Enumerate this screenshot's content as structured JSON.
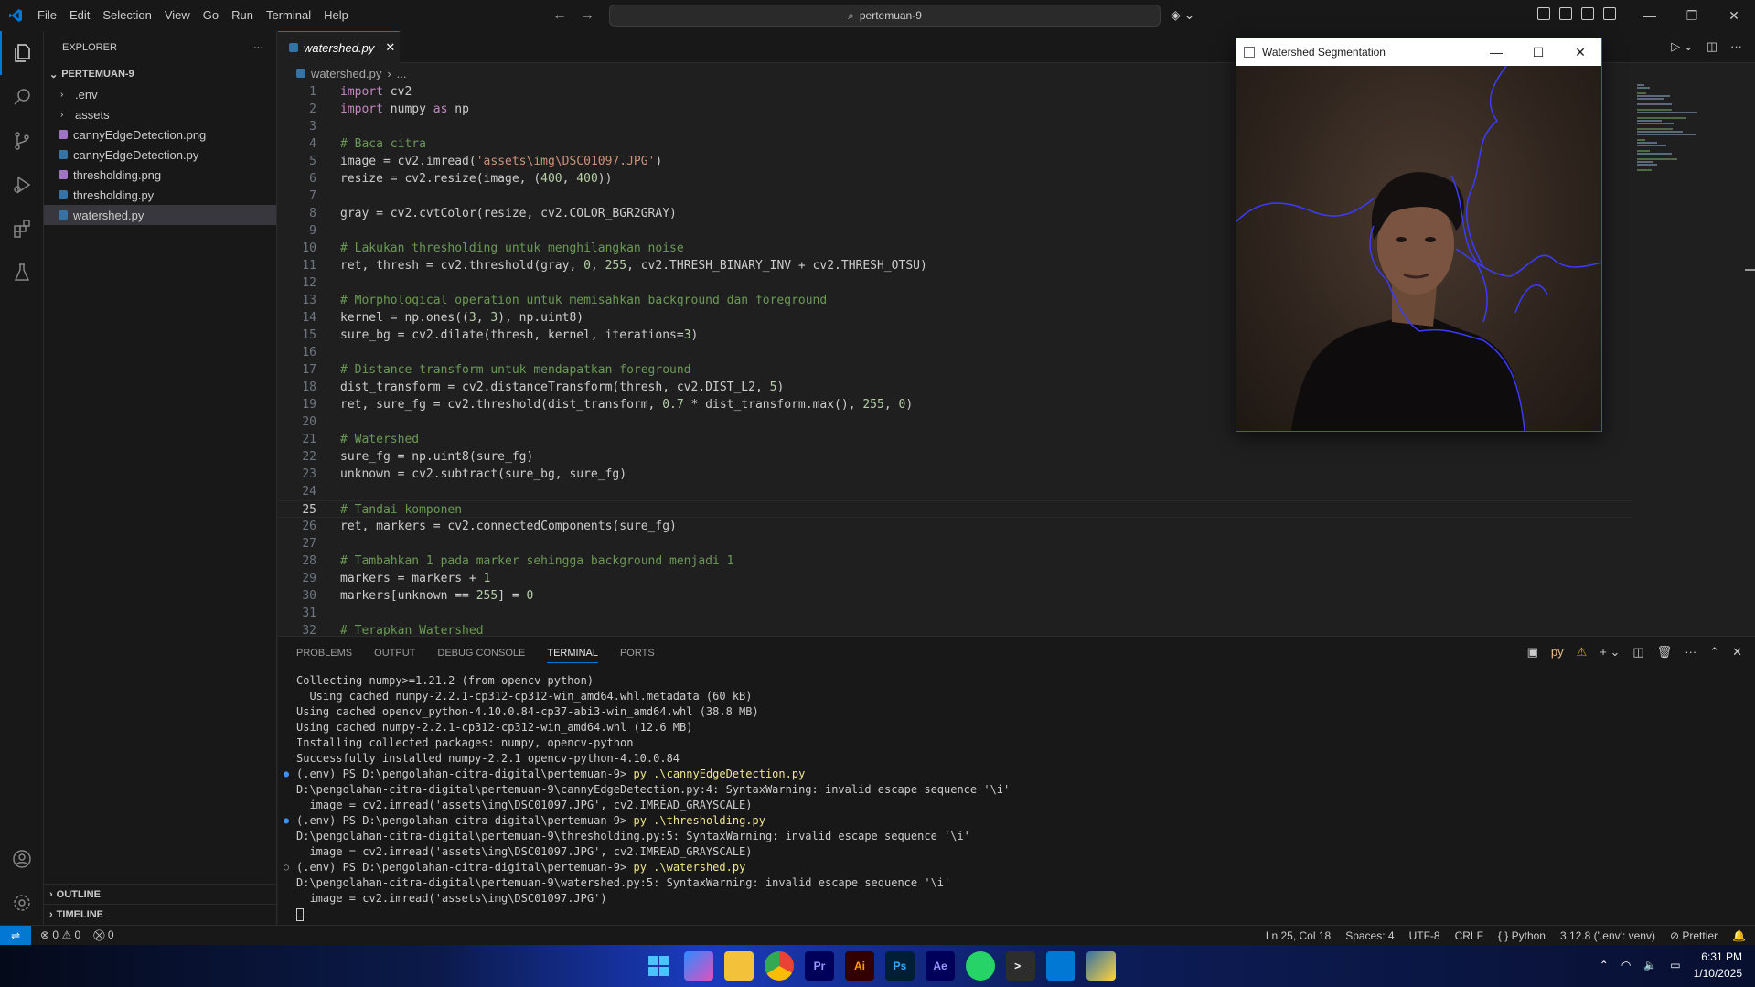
{
  "titlebar": {
    "menu": [
      "File",
      "Edit",
      "Selection",
      "View",
      "Go",
      "Run",
      "Terminal",
      "Help"
    ],
    "search_text": "pertemuan-9"
  },
  "explorer": {
    "title": "EXPLORER",
    "folder": "PERTEMUAN-9",
    "items": [
      {
        "name": ".env",
        "kind": "folder"
      },
      {
        "name": "assets",
        "kind": "folder"
      },
      {
        "name": "cannyEdgeDetection.png",
        "kind": "png"
      },
      {
        "name": "cannyEdgeDetection.py",
        "kind": "py"
      },
      {
        "name": "thresholding.png",
        "kind": "png"
      },
      {
        "name": "thresholding.py",
        "kind": "py"
      },
      {
        "name": "watershed.py",
        "kind": "py",
        "selected": true
      }
    ],
    "outline": "OUTLINE",
    "timeline": "TIMELINE"
  },
  "editor": {
    "tab_label": "watershed.py",
    "breadcrumb_file": "watershed.py",
    "breadcrumb_more": "...",
    "current_line": 25,
    "lines": [
      "import cv2",
      "import numpy as np",
      "",
      "# Baca citra",
      "image = cv2.imread('assets\\img\\DSC01097.JPG')",
      "resize = cv2.resize(image, (400, 400))",
      "",
      "gray = cv2.cvtColor(resize, cv2.COLOR_BGR2GRAY)",
      "",
      "# Lakukan thresholding untuk menghilangkan noise",
      "ret, thresh = cv2.threshold(gray, 0, 255, cv2.THRESH_BINARY_INV + cv2.THRESH_OTSU)",
      "",
      "# Morphological operation untuk memisahkan background dan foreground",
      "kernel = np.ones((3, 3), np.uint8)",
      "sure_bg = cv2.dilate(thresh, kernel, iterations=3)",
      "",
      "# Distance transform untuk mendapatkan foreground",
      "dist_transform = cv2.distanceTransform(thresh, cv2.DIST_L2, 5)",
      "ret, sure_fg = cv2.threshold(dist_transform, 0.7 * dist_transform.max(), 255, 0)",
      "",
      "# Watershed",
      "sure_fg = np.uint8(sure_fg)",
      "unknown = cv2.subtract(sure_bg, sure_fg)",
      "",
      "# Tandai komponen",
      "ret, markers = cv2.connectedComponents(sure_fg)",
      "",
      "# Tambahkan 1 pada marker sehingga background menjadi 1",
      "markers = markers + 1",
      "markers[unknown == 255] = 0",
      "",
      "# Terapkan Watershed"
    ]
  },
  "panel": {
    "tabs": [
      "PROBLEMS",
      "OUTPUT",
      "DEBUG CONSOLE",
      "TERMINAL",
      "PORTS"
    ],
    "active_tab": "TERMINAL",
    "shell_label": "py",
    "terminal_lines": [
      {
        "text": "Collecting numpy>=1.21.2 (from opencv-python)"
      },
      {
        "text": "  Using cached numpy-2.2.1-cp312-cp312-win_amd64.whl.metadata (60 kB)"
      },
      {
        "text": "Using cached opencv_python-4.10.0.84-cp37-abi3-win_amd64.whl (38.8 MB)"
      },
      {
        "text": "Using cached numpy-2.2.1-cp312-cp312-win_amd64.whl (12.6 MB)"
      },
      {
        "text": "Installing collected packages: numpy, opencv-python"
      },
      {
        "text": "Successfully installed numpy-2.2.1 opencv-python-4.10.0.84"
      },
      {
        "prompt": "(.env) PS D:\\pengolahan-citra-digital\\pertemuan-9> ",
        "cmd": "py .\\cannyEdgeDetection.py",
        "dot": "filled"
      },
      {
        "text": "D:\\pengolahan-citra-digital\\pertemuan-9\\cannyEdgeDetection.py:4: SyntaxWarning: invalid escape sequence '\\i'"
      },
      {
        "text": "  image = cv2.imread('assets\\img\\DSC01097.JPG', cv2.IMREAD_GRAYSCALE)"
      },
      {
        "prompt": "(.env) PS D:\\pengolahan-citra-digital\\pertemuan-9> ",
        "cmd": "py .\\thresholding.py",
        "dot": "filled"
      },
      {
        "text": "D:\\pengolahan-citra-digital\\pertemuan-9\\thresholding.py:5: SyntaxWarning: invalid escape sequence '\\i'"
      },
      {
        "text": "  image = cv2.imread('assets\\img\\DSC01097.JPG', cv2.IMREAD_GRAYSCALE)"
      },
      {
        "prompt": "(.env) PS D:\\pengolahan-citra-digital\\pertemuan-9> ",
        "cmd": "py .\\watershed.py",
        "dot": "hollow"
      },
      {
        "text": "D:\\pengolahan-citra-digital\\pertemuan-9\\watershed.py:5: SyntaxWarning: invalid escape sequence '\\i'"
      },
      {
        "text": "  image = cv2.imread('assets\\img\\DSC01097.JPG')"
      }
    ]
  },
  "statusbar": {
    "errors": "0",
    "warnings": "0",
    "ports": "0",
    "position": "Ln 25, Col 18",
    "spaces": "Spaces: 4",
    "encoding": "UTF-8",
    "eol": "CRLF",
    "language": "Python",
    "interpreter": "3.12.8 ('.env': venv)",
    "formatter": "Prettier"
  },
  "cv_window": {
    "title": "Watershed Segmentation"
  },
  "taskbar": {
    "apps": [
      "windows-start",
      "copilot",
      "file-explorer",
      "chrome",
      "Pr",
      "Ai",
      "Ps",
      "Ae",
      "whatsapp",
      "terminal",
      "vscode",
      "python"
    ],
    "time": "6:31 PM",
    "date": "1/10/2025"
  },
  "colors": {
    "accent": "#0078d4",
    "watershed_line": "#3b3bff",
    "keyword": "#c586c0",
    "comment": "#6a9955"
  }
}
